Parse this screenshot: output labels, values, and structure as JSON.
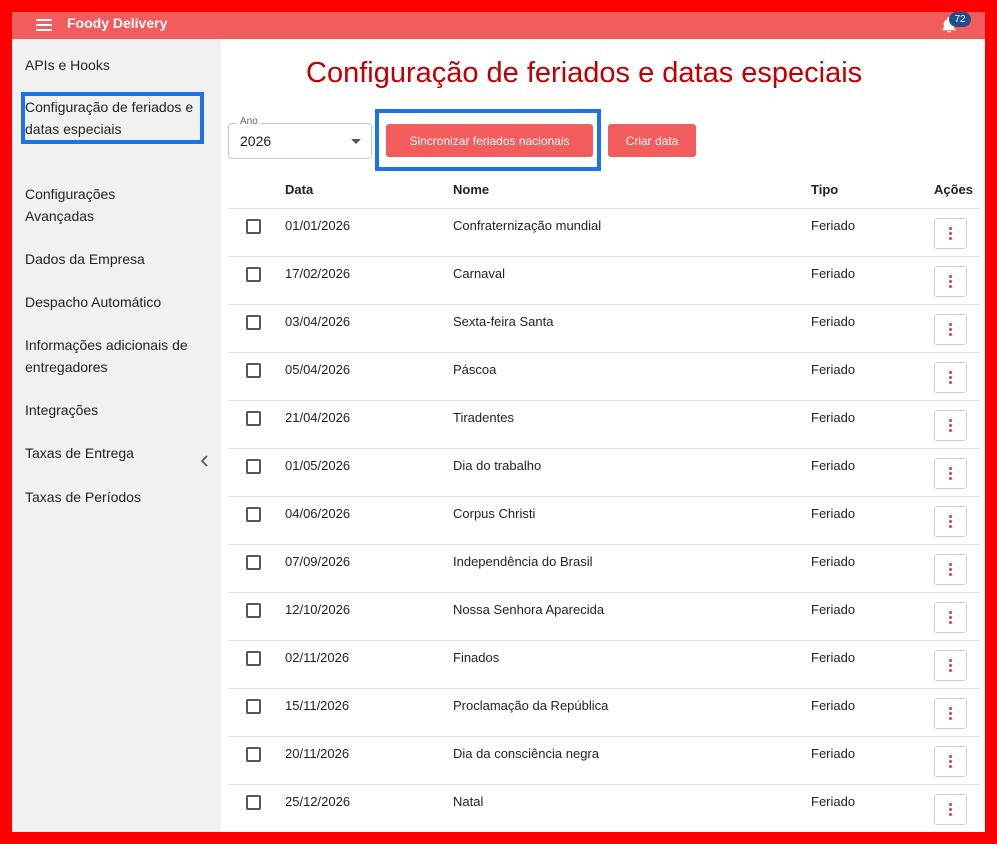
{
  "app": {
    "title": "Foody Delivery",
    "notifications": "72"
  },
  "colors": {
    "topbar": "#f35c5c",
    "title": "#c00000",
    "highlight": "#1a73e8",
    "frame": "#ff0000"
  },
  "sidebar": {
    "items": [
      {
        "label": "APIs e Hooks"
      },
      {
        "label": "Configuração de feriados e datas especiais"
      },
      {
        "label": "Configurações Avançadas"
      },
      {
        "label": "Dados da Empresa"
      },
      {
        "label": "Despacho Automático"
      },
      {
        "label": "Informações adicionais de entregadores"
      },
      {
        "label": "Integrações"
      },
      {
        "label": "Taxas de Entrega"
      },
      {
        "label": "Taxas de Períodos"
      }
    ],
    "collapse_icon": "chevron-left-icon"
  },
  "main": {
    "title": "Configuração de feriados e datas especiais",
    "year": {
      "label": "Ano",
      "value": "2026"
    },
    "sync_button": "Sincronizar feriados nacionais",
    "create_button": "Criar data",
    "table": {
      "headers": {
        "date": "Data",
        "name": "Nome",
        "type": "Tipo",
        "actions": "Ações"
      },
      "rows": [
        {
          "date": "01/01/2026",
          "name": "Confraternização mundial",
          "type": "Feriado"
        },
        {
          "date": "17/02/2026",
          "name": "Carnaval",
          "type": "Feriado"
        },
        {
          "date": "03/04/2026",
          "name": "Sexta-feira Santa",
          "type": "Feriado"
        },
        {
          "date": "05/04/2026",
          "name": "Páscoa",
          "type": "Feriado"
        },
        {
          "date": "21/04/2026",
          "name": "Tiradentes",
          "type": "Feriado"
        },
        {
          "date": "01/05/2026",
          "name": "Dia do trabalho",
          "type": "Feriado"
        },
        {
          "date": "04/06/2026",
          "name": "Corpus Christi",
          "type": "Feriado"
        },
        {
          "date": "07/09/2026",
          "name": "Independência do Brasil",
          "type": "Feriado"
        },
        {
          "date": "12/10/2026",
          "name": "Nossa Senhora Aparecida",
          "type": "Feriado"
        },
        {
          "date": "02/11/2026",
          "name": "Finados",
          "type": "Feriado"
        },
        {
          "date": "15/11/2026",
          "name": "Proclamação da República",
          "type": "Feriado"
        },
        {
          "date": "20/11/2026",
          "name": "Dia da consciência negra",
          "type": "Feriado"
        },
        {
          "date": "25/12/2026",
          "name": "Natal",
          "type": "Feriado"
        }
      ]
    }
  }
}
